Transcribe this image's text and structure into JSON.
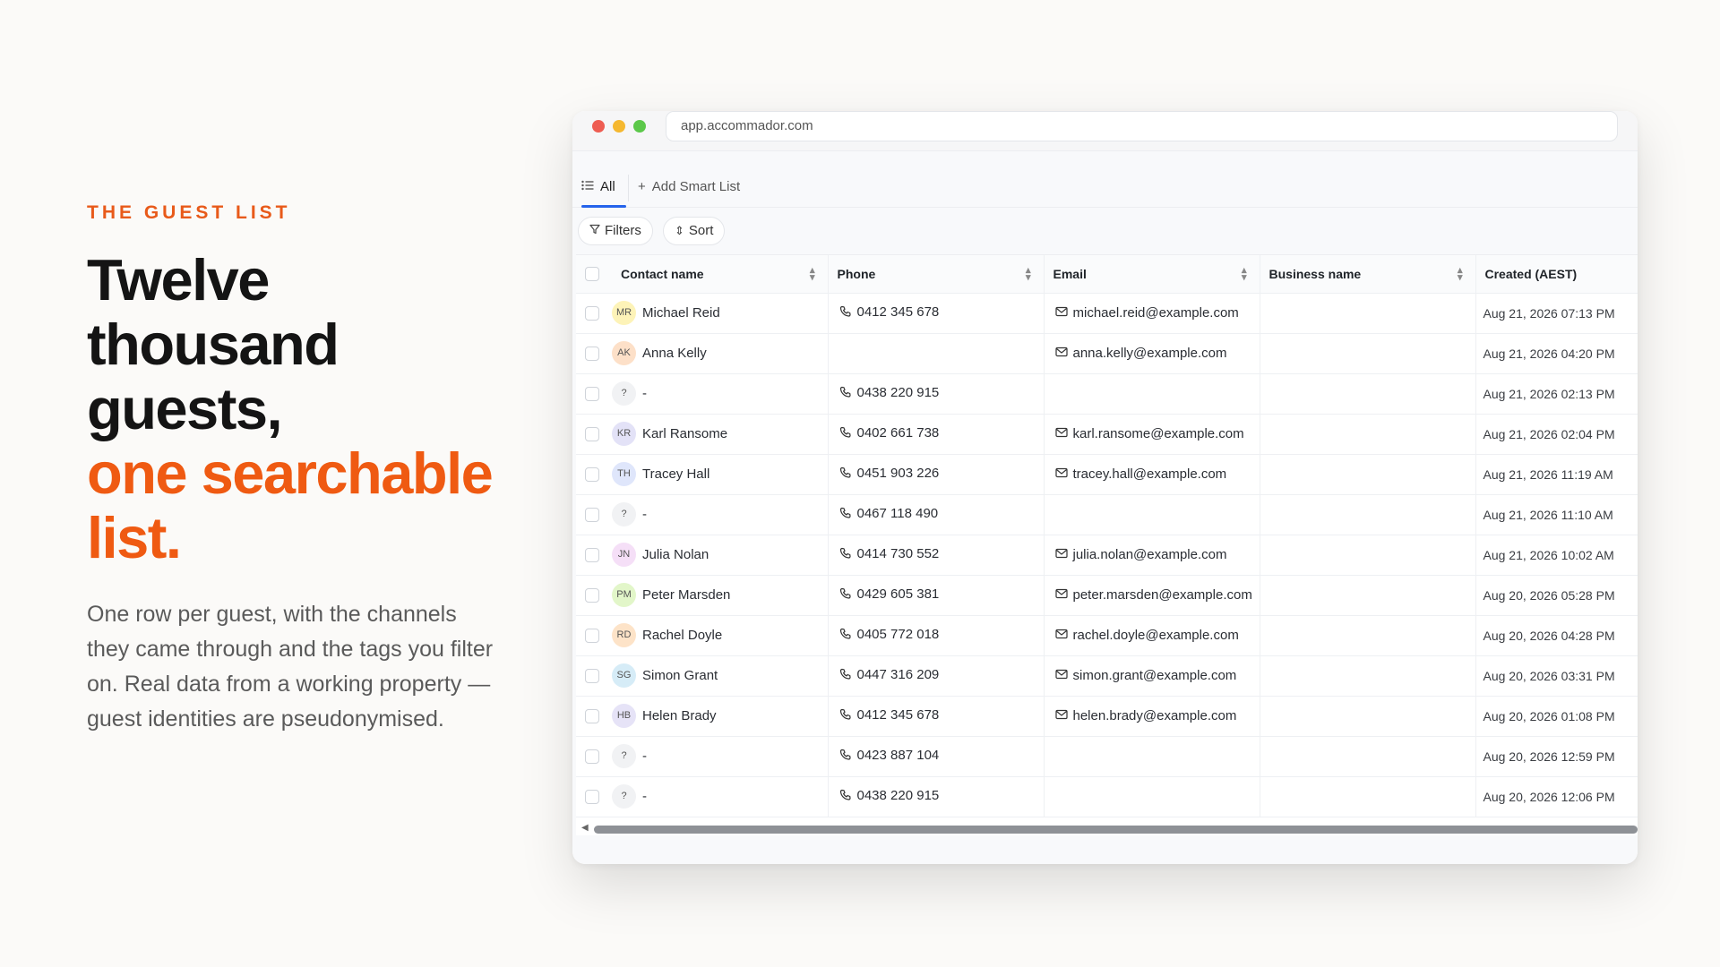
{
  "hero": {
    "eyebrow": "THE GUEST LIST",
    "headline_dark": "Twelve thousand guests,",
    "headline_accent": "one searchable list.",
    "lede": "One row per guest, with the channels they came through and the tags you filter on. Real data from a working property — guest identities are pseudonymised."
  },
  "browser": {
    "url": "app.accommador.com"
  },
  "tabs": {
    "all_label": "All",
    "add_label": "Add Smart List"
  },
  "toolbar": {
    "filters_label": "Filters",
    "sort_label": "Sort"
  },
  "table": {
    "columns": {
      "name": "Contact name",
      "phone": "Phone",
      "email": "Email",
      "business": "Business name",
      "created": "Created (AEST)"
    },
    "rows": [
      {
        "initials": "MR",
        "color": "#fdf3b8",
        "name": "Michael Reid",
        "phone": "0412 345 678",
        "email": "michael.reid@example.com",
        "business": "",
        "created": "Aug 21, 2026 07:13 PM"
      },
      {
        "initials": "AK",
        "color": "#fde0c8",
        "name": "Anna Kelly",
        "phone": "",
        "email": "anna.kelly@example.com",
        "business": "",
        "created": "Aug 21, 2026 04:20 PM"
      },
      {
        "initials": "?",
        "color": "#f1f2f4",
        "name": "-",
        "phone": "0438 220 915",
        "email": "",
        "business": "",
        "created": "Aug 21, 2026 02:13 PM"
      },
      {
        "initials": "KR",
        "color": "#e3e2f7",
        "name": "Karl Ransome",
        "phone": "0402 661 738",
        "email": "karl.ransome@example.com",
        "business": "",
        "created": "Aug 21, 2026 02:04 PM"
      },
      {
        "initials": "TH",
        "color": "#dfe6fb",
        "name": "Tracey Hall",
        "phone": "0451 903 226",
        "email": "tracey.hall@example.com",
        "business": "",
        "created": "Aug 21, 2026 11:19 AM"
      },
      {
        "initials": "?",
        "color": "#f1f2f4",
        "name": "-",
        "phone": "0467 118 490",
        "email": "",
        "business": "",
        "created": "Aug 21, 2026 11:10 AM"
      },
      {
        "initials": "JN",
        "color": "#f5dff7",
        "name": "Julia Nolan",
        "phone": "0414 730 552",
        "email": "julia.nolan@example.com",
        "business": "",
        "created": "Aug 21, 2026 10:02 AM"
      },
      {
        "initials": "PM",
        "color": "#e2f6c9",
        "name": "Peter Marsden",
        "phone": "0429 605 381",
        "email": "peter.marsden@example.com",
        "business": "",
        "created": "Aug 20, 2026 05:28 PM"
      },
      {
        "initials": "RD",
        "color": "#fde3c8",
        "name": "Rachel Doyle",
        "phone": "0405 772 018",
        "email": "rachel.doyle@example.com",
        "business": "",
        "created": "Aug 20, 2026 04:28 PM"
      },
      {
        "initials": "SG",
        "color": "#d6ecf7",
        "name": "Simon Grant",
        "phone": "0447 316 209",
        "email": "simon.grant@example.com",
        "business": "",
        "created": "Aug 20, 2026 03:31 PM"
      },
      {
        "initials": "HB",
        "color": "#e6e3f7",
        "name": "Helen Brady",
        "phone": "0412 345 678",
        "email": "helen.brady@example.com",
        "business": "",
        "created": "Aug 20, 2026 01:08 PM"
      },
      {
        "initials": "?",
        "color": "#f1f2f4",
        "name": "-",
        "phone": "0423 887 104",
        "email": "",
        "business": "",
        "created": "Aug 20, 2026 12:59 PM"
      },
      {
        "initials": "?",
        "color": "#f1f2f4",
        "name": "-",
        "phone": "0438 220 915",
        "email": "",
        "business": "",
        "created": "Aug 20, 2026 12:06 PM"
      }
    ]
  },
  "colors": {
    "accent": "#ef5a12",
    "tab_underline": "#2563eb"
  }
}
